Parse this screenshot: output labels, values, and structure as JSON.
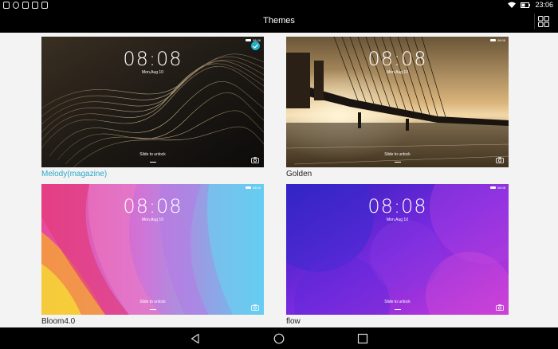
{
  "status_bar": {
    "left_icons": [
      "screenshot-icon",
      "message-icon",
      "image-icon",
      "email-icon",
      "camera-icon"
    ],
    "time": "23:06"
  },
  "header": {
    "title": "Themes"
  },
  "themes": [
    {
      "name": "Melody(magazine)",
      "selected": true,
      "clock": "08:08",
      "date": "Mon,Aug 10",
      "slide_text": "Slide to unlock",
      "status_time": "08:08"
    },
    {
      "name": "Golden",
      "selected": false,
      "clock": "08:08",
      "date": "Mon,Aug 10",
      "slide_text": "Slide to unlock",
      "status_time": "08:08"
    },
    {
      "name": "Bloom4.0",
      "selected": false,
      "clock": "08:08",
      "date": "Mon,Aug 10",
      "slide_text": "Slide to unlock",
      "status_time": "08:08"
    },
    {
      "name": "flow",
      "selected": false,
      "clock": "08:08",
      "date": "Mon,Aug 10",
      "slide_text": "Slide to unlock",
      "status_time": "08:08"
    }
  ],
  "colors": {
    "accent": "#2aa8c8",
    "background": "#f3f3f3",
    "bars": "#000000"
  }
}
